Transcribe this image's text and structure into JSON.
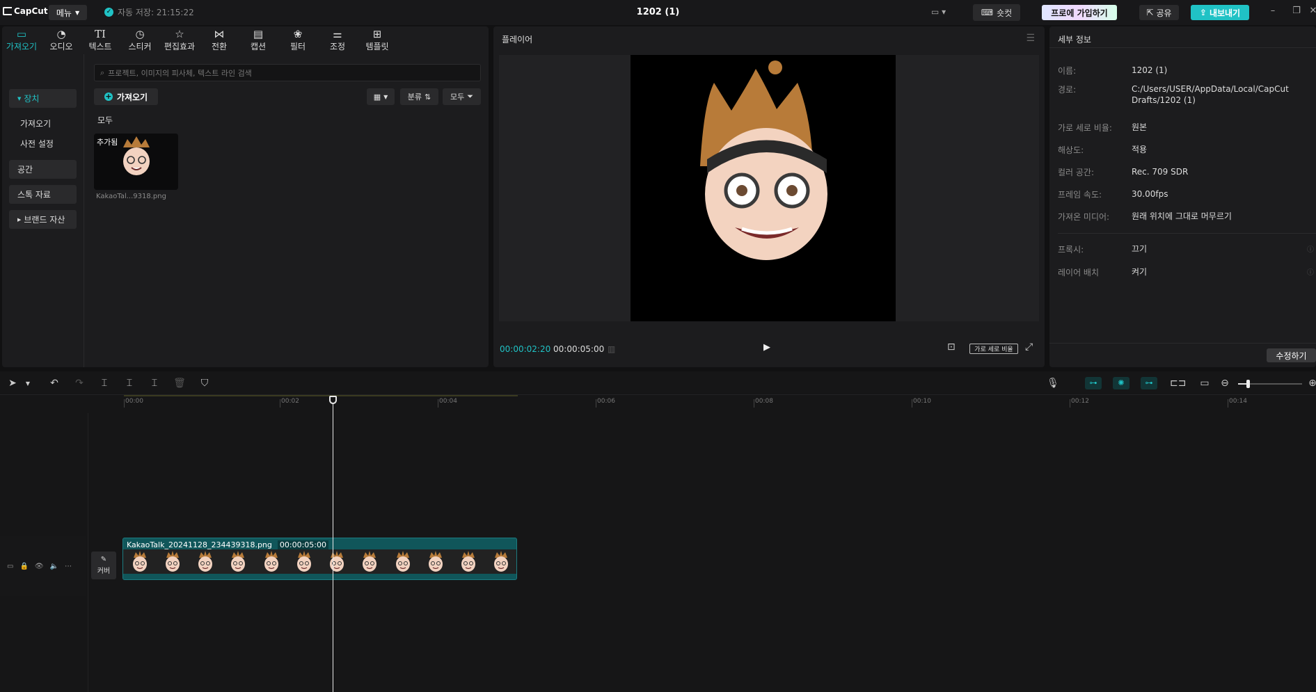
{
  "titlebar": {
    "logo": "CapCut",
    "menu_label": "메뉴",
    "autosave": "자동 저장: 21:15:22",
    "project_title": "1202 (1)",
    "shortcut_label": "숏컷",
    "pro_label": "프로에 가입하기",
    "share_label": "공유",
    "export_label": "내보내기"
  },
  "tools": [
    {
      "label": "가져오기",
      "icon": "import-icon"
    },
    {
      "label": "오디오",
      "icon": "audio-icon"
    },
    {
      "label": "텍스트",
      "icon": "text-icon"
    },
    {
      "label": "스티커",
      "icon": "sticker-icon"
    },
    {
      "label": "편집효과",
      "icon": "effects-icon"
    },
    {
      "label": "전환",
      "icon": "transition-icon"
    },
    {
      "label": "캡션",
      "icon": "caption-icon"
    },
    {
      "label": "필터",
      "icon": "filter-icon"
    },
    {
      "label": "조정",
      "icon": "adjust-icon"
    },
    {
      "label": "템플릿",
      "icon": "template-icon"
    }
  ],
  "left_nav": {
    "device": "장치",
    "import": "가져오기",
    "preset": "사전 설정",
    "space": "공간",
    "stock": "스톡 자료",
    "brand": "브랜드 자산"
  },
  "media": {
    "search_placeholder": "프로젝트, 이미지의 피사체, 텍스트 라인 검색",
    "import_button": "가져오기",
    "sort_label": "분류",
    "filter_label": "모두",
    "section_all": "모두",
    "thumb_tag": "추가됨",
    "thumb_name": "KakaoTal...9318.png"
  },
  "player": {
    "title": "플레이어",
    "current_time": "00:00:02:20",
    "total_time": "00:00:05:00",
    "ratio_label": "가로 세로 비율"
  },
  "details": {
    "title": "세부 정보",
    "rows": [
      {
        "key": "이름:",
        "value": "1202 (1)"
      },
      {
        "key": "경로:",
        "value": "C:/Users/USER/AppData/Local/CapCut Drafts/1202 (1)"
      },
      {
        "key": "가로 세로 비율:",
        "value": "원본"
      },
      {
        "key": "해상도:",
        "value": "적용"
      },
      {
        "key": "컬러 공간:",
        "value": "Rec. 709 SDR"
      },
      {
        "key": "프레임 속도:",
        "value": "30.00fps"
      },
      {
        "key": "가져온 미디어:",
        "value": "원래 위치에 그대로 머무르기"
      }
    ],
    "rows2": [
      {
        "key": "프록시:",
        "value": "끄기"
      },
      {
        "key": "레이어 배치",
        "value": "켜기"
      }
    ],
    "modify_button": "수정하기"
  },
  "timeline": {
    "ruler_labels": [
      "00:00",
      "00:02",
      "00:04",
      "00:06",
      "00:08",
      "00:10",
      "00:12",
      "00:14"
    ],
    "cover_label": "커버",
    "clip_name": "KakaoTalk_20241128_234439318.png",
    "clip_duration": "00:00:05:00"
  },
  "colors": {
    "accent": "#20c2c5",
    "clip": "#10565a"
  }
}
